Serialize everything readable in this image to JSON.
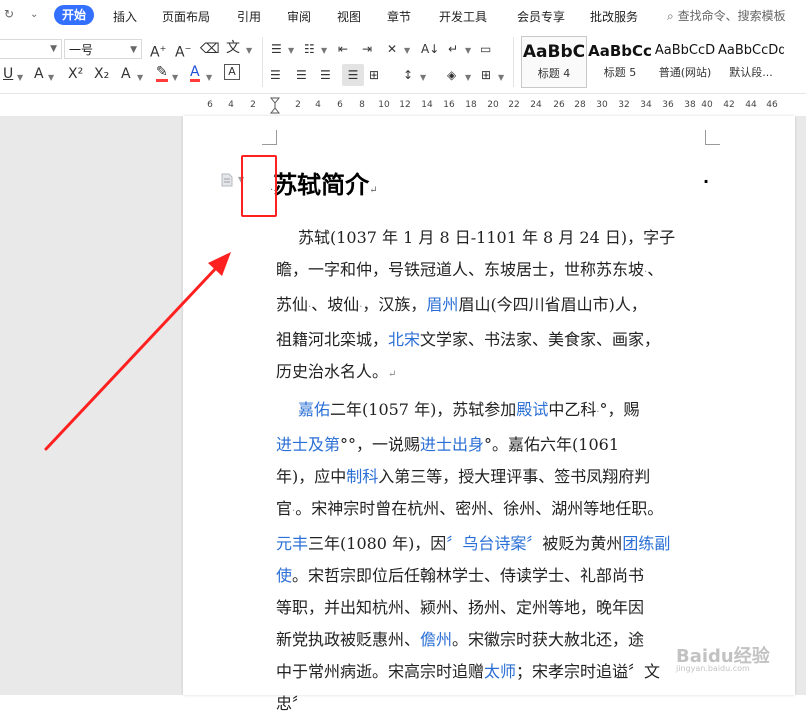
{
  "menu": {
    "items": [
      "开始",
      "插入",
      "页面布局",
      "引用",
      "审阅",
      "视图",
      "章节",
      "开发工具",
      "会员专享",
      "批改服务"
    ],
    "active_index": 0,
    "search": "查找命令、搜索模板"
  },
  "toolbar": {
    "font_size": "一号",
    "styles": [
      {
        "sample": "AaBbC",
        "name": "标题 4"
      },
      {
        "sample": "AaBbCc",
        "name": "标题 5"
      },
      {
        "sample": "AaBbCcD",
        "name": "普通(网站)"
      },
      {
        "sample": "AaBbCcDd",
        "name": "默认段..."
      }
    ]
  },
  "ruler": {
    "labels": [
      "6",
      "4",
      "2",
      "2",
      "4",
      "6",
      "8",
      "10",
      "12",
      "14",
      "16",
      "18",
      "20",
      "22",
      "24",
      "26",
      "28",
      "30",
      "32",
      "34",
      "36",
      "38",
      "40",
      "42",
      "44",
      "46"
    ]
  },
  "document": {
    "heading": "苏轼简介",
    "paragraph1": [
      [
        {
          "t": "苏轼(1037 年 1 月 8 日-1101 年 8 月 24 日)，字子"
        }
      ],
      [
        {
          "t": "瞻，一字和仲，号铁冠道人、东坡居士，世称苏东坡"
        },
        {
          "t": "·",
          "m": true
        },
        {
          "t": "、"
        }
      ],
      [
        {
          "t": "苏仙"
        },
        {
          "t": "·",
          "m": true
        },
        {
          "t": "、坡仙"
        },
        {
          "t": "·",
          "m": true
        },
        {
          "t": "，汉族，"
        },
        {
          "t": "眉州",
          "l": true
        },
        {
          "t": "眉山(今四川省眉山市)人，"
        }
      ],
      [
        {
          "t": "祖籍河北栾城，"
        },
        {
          "t": "北宋",
          "l": true
        },
        {
          "t": "文学家、书法家、美食家、画家，"
        }
      ],
      [
        {
          "t": "历史治水名人。"
        },
        {
          "t": "↵",
          "m": true
        }
      ]
    ],
    "paragraph2": [
      [
        {
          "t": "嘉佑",
          "l": true
        },
        {
          "t": "二年(1057 年)，苏轼参加"
        },
        {
          "t": "殿试",
          "l": true
        },
        {
          "t": "中乙科"
        },
        {
          "t": "·",
          "m": true
        },
        {
          "t": "°，赐"
        }
      ],
      [
        {
          "t": "进士及第",
          "l": true
        },
        {
          "t": "°°，一说赐"
        },
        {
          "t": "进士出身",
          "l": true
        },
        {
          "t": "°。嘉佑六年(1061"
        }
      ],
      [
        {
          "t": "年)，应中"
        },
        {
          "t": "制科",
          "l": true
        },
        {
          "t": "入第三等，授大理评事、签书凤翔府判"
        }
      ],
      [
        {
          "t": "官"
        },
        {
          "t": "·",
          "m": true
        },
        {
          "t": "。宋神宗时曾在杭州、密州、徐州、湖州等地任职。"
        }
      ],
      [
        {
          "t": "元丰",
          "l": true
        },
        {
          "t": "三年(1080 年)，因"
        },
        {
          "t": "〞乌台诗案〞",
          "l": true
        },
        {
          "t": "被贬为黄州"
        },
        {
          "t": "团练副",
          "l": true
        }
      ],
      [
        {
          "t": "使",
          "l": true
        },
        {
          "t": "。宋哲宗即位后任翰林学士、侍读学士、礼部尚书"
        }
      ],
      [
        {
          "t": "等职，并出知杭州、颍州、扬州、定州等地，晚年因"
        }
      ],
      [
        {
          "t": "新党执政被贬惠州、"
        },
        {
          "t": "儋州",
          "l": true
        },
        {
          "t": "。宋徽宗时获大赦北还，途"
        }
      ],
      [
        {
          "t": "中于常州病逝。宋高宗时追赠"
        },
        {
          "t": "太师",
          "l": true
        },
        {
          "t": "；宋孝宗时追谥〞文"
        }
      ],
      [
        {
          "t": "忠〞"
        }
      ]
    ]
  },
  "watermark": {
    "main": "Baidu经验",
    "sub": "jingyan.baidu.com"
  },
  "colors": {
    "accent": "#3370ff",
    "link": "#2a6fd6",
    "highlight": "#ff2020"
  }
}
